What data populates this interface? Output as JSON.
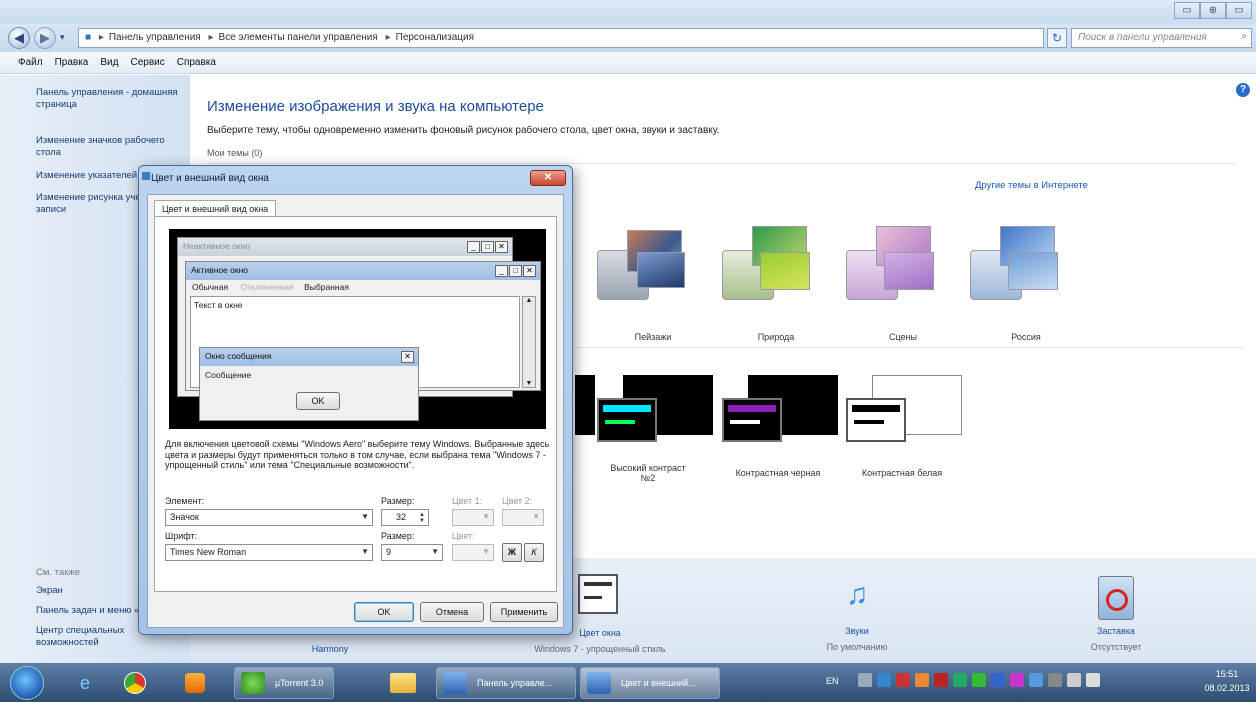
{
  "window": {
    "caption_buttons": [
      "▭",
      "⊕",
      "▭"
    ],
    "breadcrumbs": [
      "Панель управления",
      "Все элементы панели управления",
      "Персонализация"
    ],
    "search_placeholder": "Поиск в панели управления"
  },
  "menu": [
    "Файл",
    "Правка",
    "Вид",
    "Сервис",
    "Справка"
  ],
  "leftnav": {
    "links": [
      "Панель управления - домашняя страница",
      "Изменение значков рабочего стола",
      "Изменение указателей мыши",
      "Изменение рисунка учетной записи"
    ],
    "see_also_title": "См. также",
    "see_also": [
      "Экран",
      "Панель задач и меню «Пуск»",
      "Центр специальных возможностей"
    ]
  },
  "main": {
    "title": "Изменение изображения и звука на компьютере",
    "description": "Выберите тему, чтобы одновременно изменить фоновый рисунок рабочего стола, цвет окна, звуки и заставку.",
    "my_themes": "Мои темы (0)",
    "online_link": "Другие темы в Интернете",
    "themes": [
      "Пейзажи",
      "Природа",
      "Сцены",
      "Россия"
    ],
    "basic_themes": [
      "Высокий контраст №2",
      "Контрастная черная",
      "Контрастная белая"
    ],
    "bottom": {
      "bg_label": "Harmony",
      "color_label": "Цвет окна",
      "color_sub": "Windows 7 - упрощенный стиль",
      "sound_label": "Звуки",
      "sound_sub": "По умолчанию",
      "saver_label": "Заставка",
      "saver_sub": "Отсутствует"
    }
  },
  "dialog": {
    "title": "Цвет и внешний вид окна",
    "tab": "Цвет и внешний вид окна",
    "preview": {
      "inactive": "Неактивное окно",
      "active": "Активное окно",
      "menu_normal": "Обычная",
      "menu_disabled": "Отключенная",
      "menu_selected": "Выбранная",
      "window_text": "Текст в окне",
      "msgbox_title": "Окно сообщения",
      "msgbox_text": "Сообщение",
      "ok": "OK"
    },
    "description": "Для включения цветовой схемы \"Windows Aero\" выберите тему Windows. Выбранные здесь цвета и размеры будут применяться только в том случае, если выбрана тема \"Windows 7 - упрощенный стиль\" или тема \"Специальные возможности\".",
    "element_label": "Элемент:",
    "size_label": "Размер:",
    "color1_label": "Цвет 1:",
    "color2_label": "Цвет 2:",
    "element_value": "Значок",
    "element_size": "32",
    "font_label": "Шрифт:",
    "font_size_label": "Размер:",
    "font_color_label": "Цвет:",
    "font_value": "Times New Roman",
    "font_size": "9",
    "bold_btn": "Ж",
    "italic_btn": "К",
    "ok_btn": "OK",
    "cancel_btn": "Отмена",
    "apply_btn": "Применить"
  },
  "taskbar": {
    "tasks": [
      "µTorrent 3.0",
      "Панель управле...",
      "Цвет и внешний..."
    ],
    "lang": "EN",
    "time": "15:51",
    "date": "08.02.2013"
  }
}
